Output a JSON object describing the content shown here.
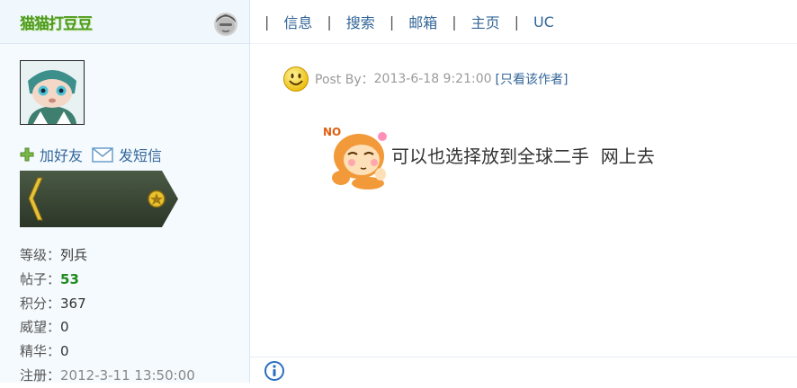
{
  "user": {
    "name": "猫猫打豆豆",
    "actions": {
      "add_friend": "加好友",
      "send_message": "发短信"
    },
    "stats": {
      "level_label": "等级：",
      "level_value": "列兵",
      "posts_label": "帖子：",
      "posts_value": "53",
      "points_label": "积分：",
      "points_value": "367",
      "prestige_label": "威望：",
      "prestige_value": "0",
      "essence_label": "精华：",
      "essence_value": "0",
      "register_label": "注册：",
      "register_value": "2012-3-11 13:50:00"
    }
  },
  "nav": {
    "separator": "|",
    "items": [
      "信息",
      "搜索",
      "邮箱",
      "主页",
      "UC"
    ]
  },
  "post": {
    "meta_prefix": "Post By：",
    "timestamp": "2013-6-18 9:21:00",
    "author_only_link": "[只看该作者]",
    "content": "可以也选择放到全球二手  网上去"
  },
  "colors": {
    "username_green": "#4e9b1e",
    "link_blue": "#336699",
    "posts_green": "#208a20"
  },
  "icons": [
    "online-status-icon",
    "plus-icon",
    "envelope-icon",
    "smiley-icon",
    "monkey-emoticon-icon",
    "info-icon"
  ]
}
